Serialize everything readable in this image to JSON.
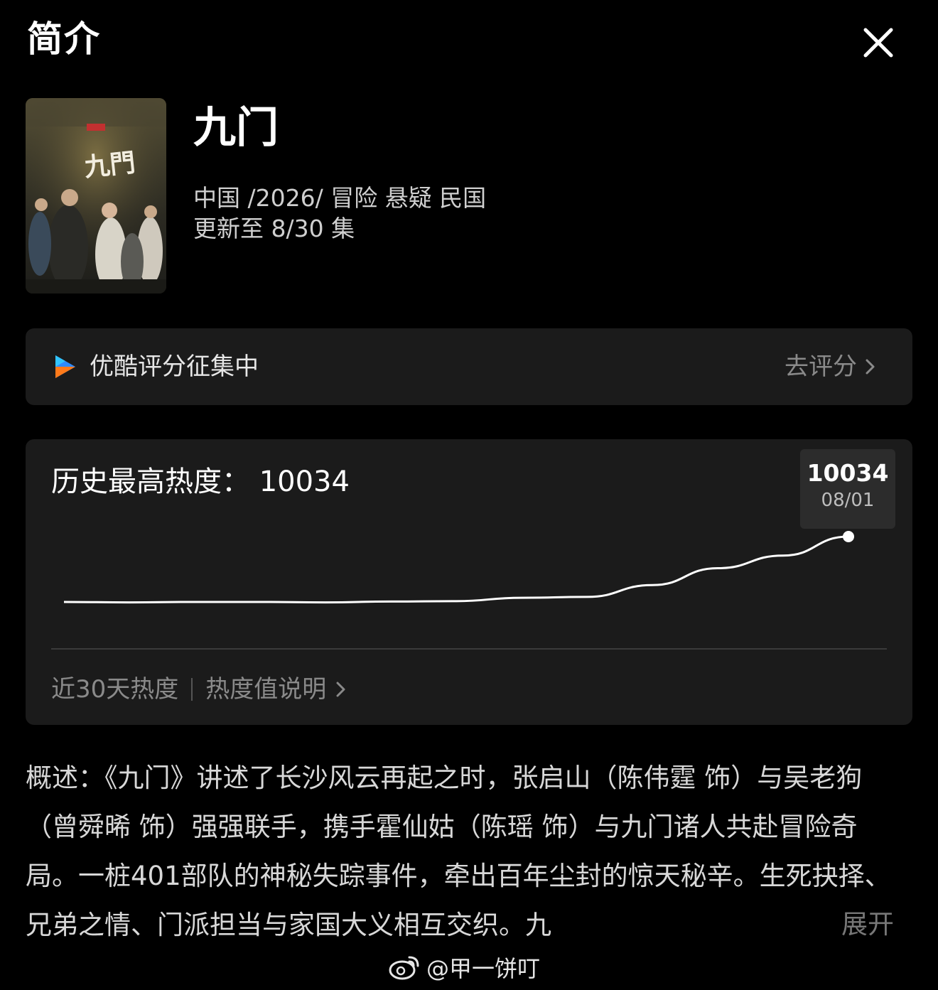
{
  "header": {
    "title": "简介"
  },
  "show": {
    "poster_title_text": "九門",
    "title": "九门",
    "meta": "中国 /2026/ 冒险  悬疑  民国",
    "update": "更新至 8/30 集"
  },
  "rating": {
    "label": "优酷评分征集中",
    "link_label": "去评分"
  },
  "heat": {
    "title": "历史最高热度：  10034",
    "tooltip_value": "10034",
    "tooltip_date": "08/01",
    "footer_period": "近30天热度",
    "footer_link": "热度值说明"
  },
  "chart_data": {
    "type": "line",
    "series": [
      {
        "values": [
          100,
          99,
          100,
          100,
          99,
          101,
          102,
          110,
          112,
          140,
          180,
          210,
          255
        ]
      }
    ],
    "highlight": {
      "value": 10034,
      "date": "08/01"
    },
    "grid": false
  },
  "synopsis": {
    "text": "概述：《九门》讲述了长沙风云再起之时，张启山（陈伟霆 饰）与吴老狗（曾舜晞 饰）强强联手，携手霍仙姑（陈瑶 饰）与九门诸人共赴冒险奇局。一桩401部队的神秘失踪事件，牵出百年尘封的惊天秘辛。生死抉择、兄弟之情、门派担当与家国大义相互交织。九",
    "expand_label": "展开"
  },
  "watermark": {
    "text": "@甲一饼叮"
  },
  "colors": {
    "background": "#000000",
    "card": "#1b1b1b",
    "muted_text": "#8a8a8a",
    "youku_blue": "#2f8bff",
    "youku_orange": "#ff7a1a"
  }
}
